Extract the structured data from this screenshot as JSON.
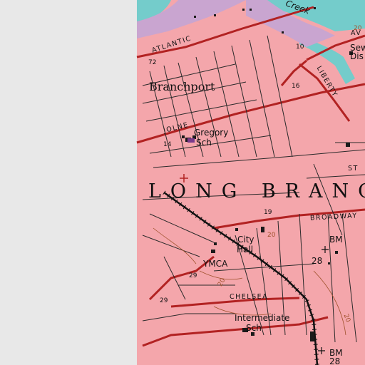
{
  "colors": {
    "urban": "#f4a6ab",
    "water": "#74cccb",
    "marsh": "#c9a5d0",
    "road_major": "#b22222",
    "road_minor": "#2a2a2a",
    "blank": "#e8e8e8"
  },
  "labels": {
    "branchport": "Branchport",
    "long_branch": "LONG BRANC",
    "atlantic": "ATLANTIC",
    "jolne": "JOLNE",
    "liberty": "LIBERTY",
    "broadway": "BROADWAY",
    "chelsea": "CHELSEA",
    "av": "AV",
    "st": "ST",
    "creek": "Creek",
    "gregory": "Gregory",
    "sch": "Sch",
    "city": "City",
    "hall": "Hall",
    "ymca": "YMCA",
    "intermediate": "Intermediate",
    "sch2": "Sch",
    "sew": "Sew",
    "dis": "Dis",
    "bm1": "BM",
    "bm1_num": "28",
    "bm2": "BM",
    "bm2_num": "28",
    "n72": "72",
    "n10": "10",
    "n16": "16",
    "n14": "14",
    "n19": "19",
    "n29a": "29",
    "n29b": "29",
    "c20a": "20",
    "c20b": "20",
    "c20c": "20",
    "c20d": "20"
  }
}
